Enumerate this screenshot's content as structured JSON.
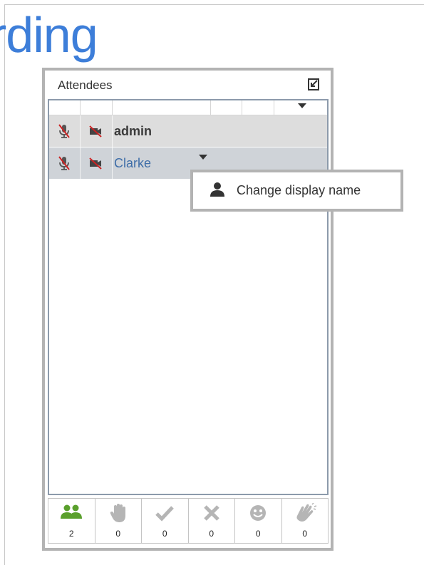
{
  "background": {
    "title_fragment": "rding"
  },
  "panel": {
    "title": "Attendees",
    "popout_icon": "popout-icon"
  },
  "attendees": [
    {
      "name": "admin",
      "mic": "mic-muted-icon",
      "camera": "camera-off-icon",
      "highlight": false
    },
    {
      "name": "Clarke",
      "mic": "mic-muted-icon",
      "camera": "camera-off-icon",
      "highlight": true
    }
  ],
  "context_menu": {
    "items": [
      {
        "label": "Change display name",
        "icon": "person-icon"
      }
    ]
  },
  "footer": {
    "stats": [
      {
        "icon": "people-icon",
        "count": "2",
        "color": "#5aa02c"
      },
      {
        "icon": "raise-hand-icon",
        "count": "0",
        "color": "#b5b5b5"
      },
      {
        "icon": "checkmark-icon",
        "count": "0",
        "color": "#b5b5b5"
      },
      {
        "icon": "cross-icon",
        "count": "0",
        "color": "#b5b5b5"
      },
      {
        "icon": "smiley-icon",
        "count": "0",
        "color": "#b5b5b5"
      },
      {
        "icon": "applause-icon",
        "count": "0",
        "color": "#b5b5b5"
      }
    ]
  },
  "colors": {
    "accent": "#3d7ed9",
    "name_link": "#3f6ea8",
    "muted_red": "#cc2222",
    "panel_border": "#b3b3b3"
  }
}
